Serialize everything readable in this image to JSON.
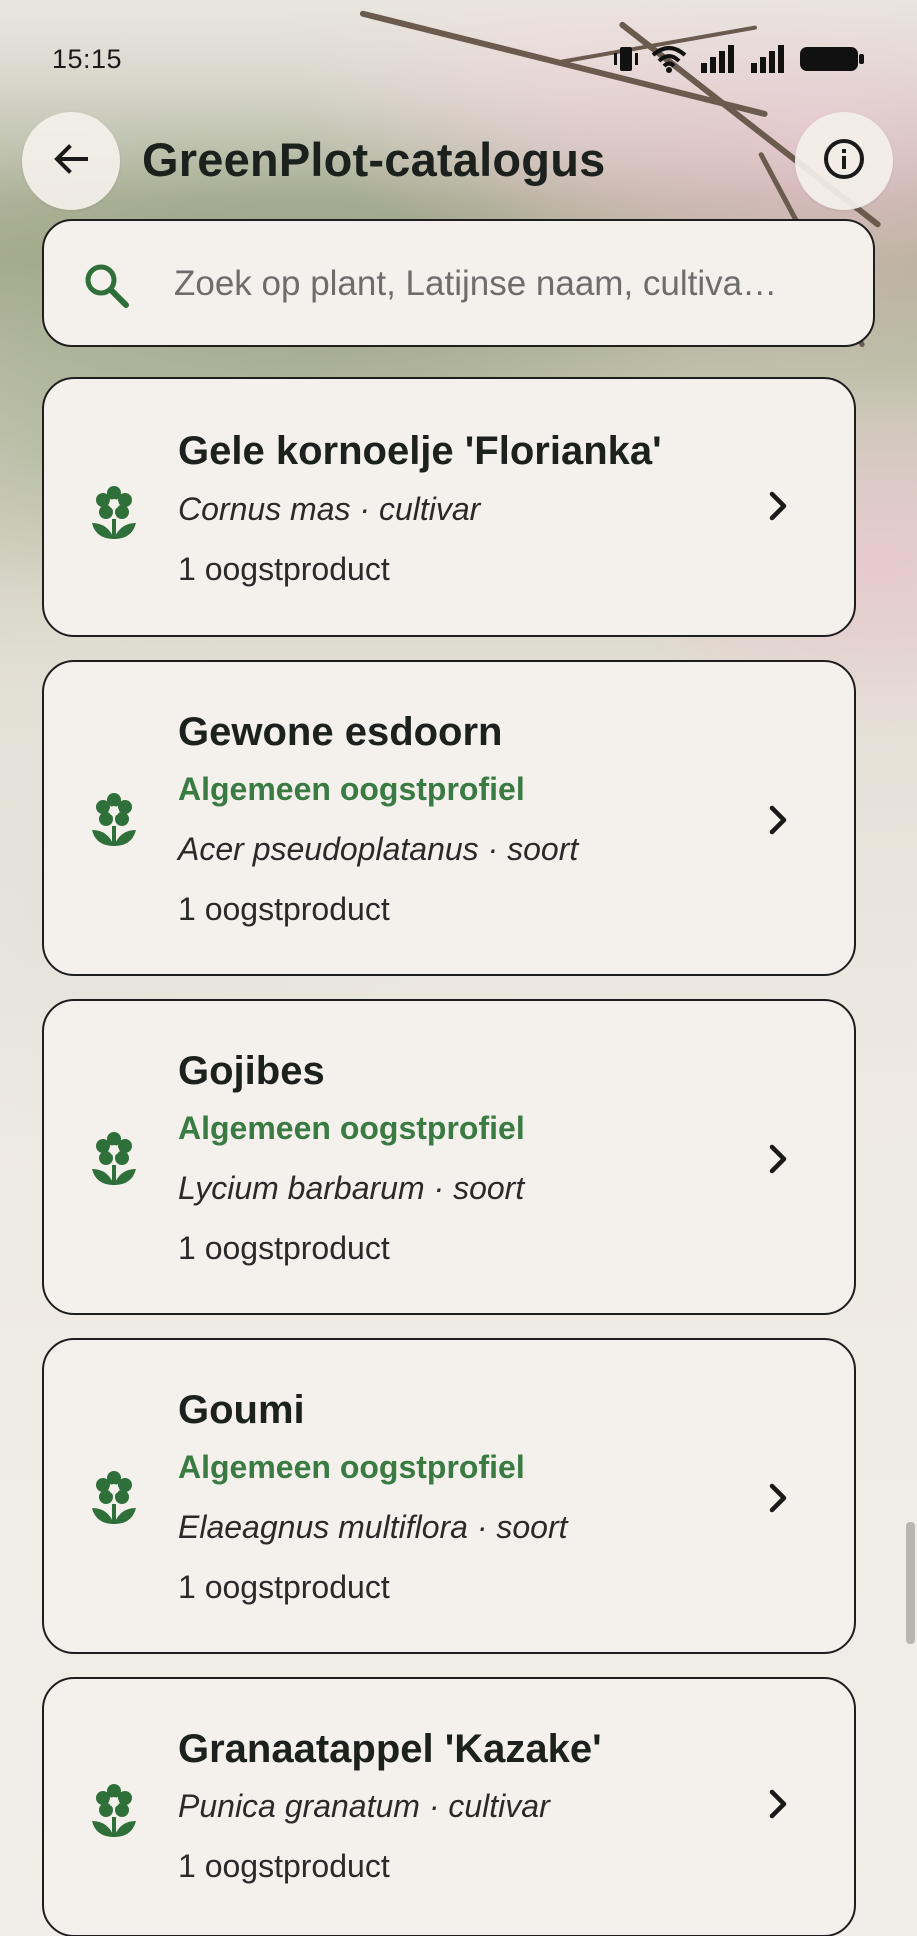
{
  "status_bar": {
    "time": "15:15",
    "icons": [
      "vibrate-icon",
      "wifi-icon",
      "signal-icon",
      "signal-icon",
      "battery-icon"
    ]
  },
  "app_bar": {
    "title": "GreenPlot-catalogus",
    "back_icon": "arrow-left-icon",
    "info_icon": "info-icon"
  },
  "search": {
    "placeholder": "Zoek op plant, Latijnse naam, cultiva…",
    "value": "",
    "icon": "search-icon"
  },
  "colors": {
    "accent_green": "#3a7a43",
    "card_background": "#f4f1ec",
    "card_border": "#1e1e1e"
  },
  "plants": [
    {
      "name": "Gele kornoelje 'Florianka'",
      "profile": "",
      "latin": "Cornus mas · cultivar",
      "count": "1 oogstproduct",
      "icon": "flower-icon"
    },
    {
      "name": "Gewone esdoorn",
      "profile": "Algemeen oogstprofiel",
      "latin": "Acer pseudoplatanus · soort",
      "count": "1 oogstproduct",
      "icon": "flower-icon"
    },
    {
      "name": "Gojibes",
      "profile": "Algemeen oogstprofiel",
      "latin": "Lycium barbarum · soort",
      "count": "1 oogstproduct",
      "icon": "flower-icon"
    },
    {
      "name": "Goumi",
      "profile": "Algemeen oogstprofiel",
      "latin": "Elaeagnus multiflora · soort",
      "count": "1 oogstproduct",
      "icon": "flower-icon"
    },
    {
      "name": "Granaatappel 'Kazake'",
      "profile": "",
      "latin": "Punica granatum · cultivar",
      "count": "1 oogstproduct",
      "icon": "flower-icon"
    }
  ]
}
